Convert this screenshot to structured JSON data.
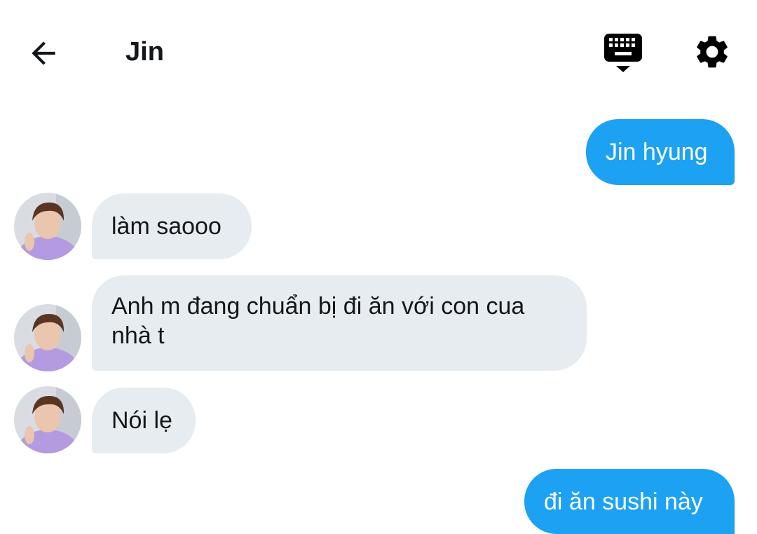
{
  "header": {
    "title": "Jin",
    "back_icon": "arrow-left-icon",
    "keyboard_icon": "keyboard-icon",
    "settings_icon": "gear-icon"
  },
  "contact": {
    "name": "Jin",
    "avatar_icon": "contact-avatar"
  },
  "messages": [
    {
      "direction": "sent",
      "text": "Jin hyung"
    },
    {
      "direction": "received",
      "text": "làm saooo"
    },
    {
      "direction": "received",
      "text": "Anh m đang chuẩn bị đi ăn với con cua nhà t"
    },
    {
      "direction": "received",
      "text": "Nói lẹ"
    },
    {
      "direction": "sent",
      "text": "đi ăn sushi này"
    }
  ],
  "colors": {
    "sent_bubble": "#1da1f2",
    "received_bubble": "#e6ecf0",
    "text_dark": "#14171a",
    "text_light": "#ffffff"
  }
}
